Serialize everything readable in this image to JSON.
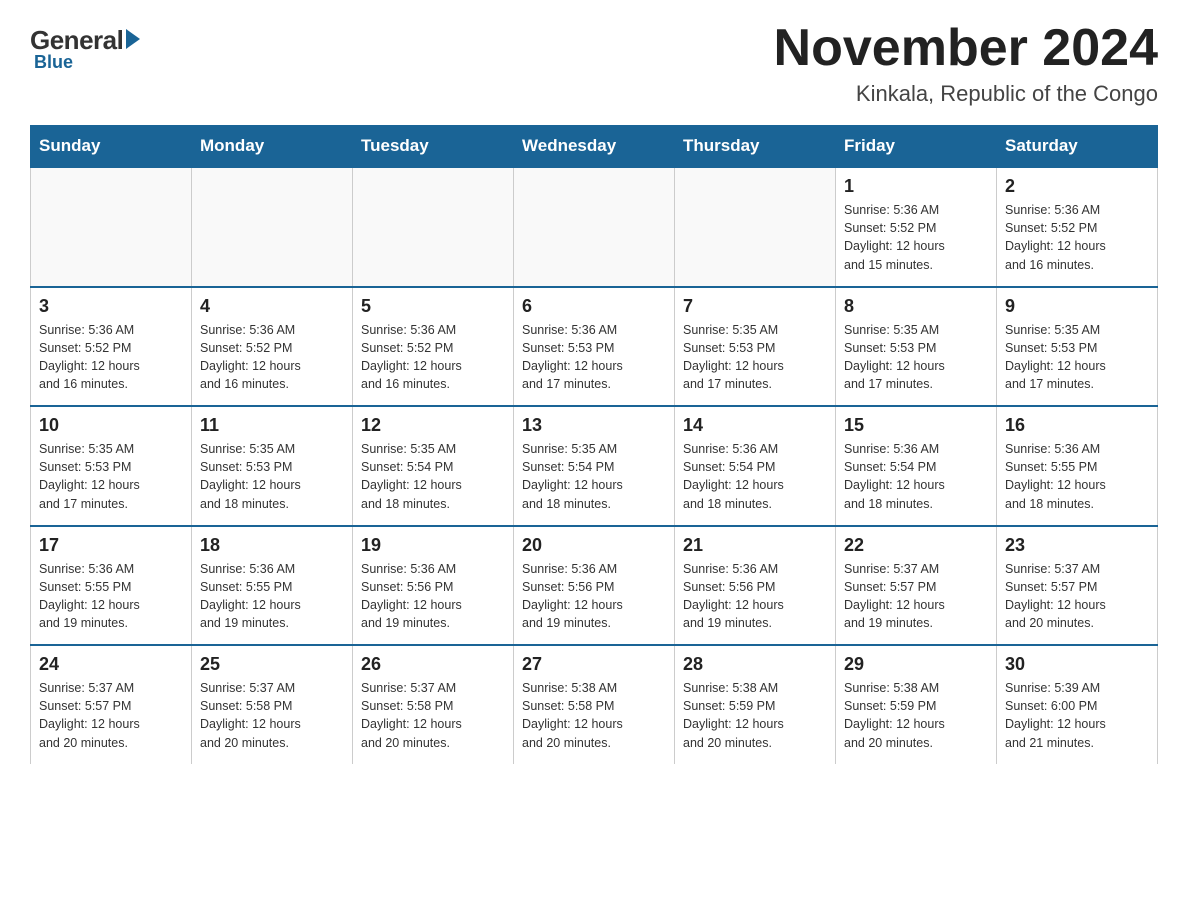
{
  "header": {
    "logo": {
      "general": "General",
      "blue": "Blue"
    },
    "title": "November 2024",
    "subtitle": "Kinkala, Republic of the Congo"
  },
  "days_of_week": [
    "Sunday",
    "Monday",
    "Tuesday",
    "Wednesday",
    "Thursday",
    "Friday",
    "Saturday"
  ],
  "weeks": [
    [
      {
        "day": "",
        "info": ""
      },
      {
        "day": "",
        "info": ""
      },
      {
        "day": "",
        "info": ""
      },
      {
        "day": "",
        "info": ""
      },
      {
        "day": "",
        "info": ""
      },
      {
        "day": "1",
        "info": "Sunrise: 5:36 AM\nSunset: 5:52 PM\nDaylight: 12 hours\nand 15 minutes."
      },
      {
        "day": "2",
        "info": "Sunrise: 5:36 AM\nSunset: 5:52 PM\nDaylight: 12 hours\nand 16 minutes."
      }
    ],
    [
      {
        "day": "3",
        "info": "Sunrise: 5:36 AM\nSunset: 5:52 PM\nDaylight: 12 hours\nand 16 minutes."
      },
      {
        "day": "4",
        "info": "Sunrise: 5:36 AM\nSunset: 5:52 PM\nDaylight: 12 hours\nand 16 minutes."
      },
      {
        "day": "5",
        "info": "Sunrise: 5:36 AM\nSunset: 5:52 PM\nDaylight: 12 hours\nand 16 minutes."
      },
      {
        "day": "6",
        "info": "Sunrise: 5:36 AM\nSunset: 5:53 PM\nDaylight: 12 hours\nand 17 minutes."
      },
      {
        "day": "7",
        "info": "Sunrise: 5:35 AM\nSunset: 5:53 PM\nDaylight: 12 hours\nand 17 minutes."
      },
      {
        "day": "8",
        "info": "Sunrise: 5:35 AM\nSunset: 5:53 PM\nDaylight: 12 hours\nand 17 minutes."
      },
      {
        "day": "9",
        "info": "Sunrise: 5:35 AM\nSunset: 5:53 PM\nDaylight: 12 hours\nand 17 minutes."
      }
    ],
    [
      {
        "day": "10",
        "info": "Sunrise: 5:35 AM\nSunset: 5:53 PM\nDaylight: 12 hours\nand 17 minutes."
      },
      {
        "day": "11",
        "info": "Sunrise: 5:35 AM\nSunset: 5:53 PM\nDaylight: 12 hours\nand 18 minutes."
      },
      {
        "day": "12",
        "info": "Sunrise: 5:35 AM\nSunset: 5:54 PM\nDaylight: 12 hours\nand 18 minutes."
      },
      {
        "day": "13",
        "info": "Sunrise: 5:35 AM\nSunset: 5:54 PM\nDaylight: 12 hours\nand 18 minutes."
      },
      {
        "day": "14",
        "info": "Sunrise: 5:36 AM\nSunset: 5:54 PM\nDaylight: 12 hours\nand 18 minutes."
      },
      {
        "day": "15",
        "info": "Sunrise: 5:36 AM\nSunset: 5:54 PM\nDaylight: 12 hours\nand 18 minutes."
      },
      {
        "day": "16",
        "info": "Sunrise: 5:36 AM\nSunset: 5:55 PM\nDaylight: 12 hours\nand 18 minutes."
      }
    ],
    [
      {
        "day": "17",
        "info": "Sunrise: 5:36 AM\nSunset: 5:55 PM\nDaylight: 12 hours\nand 19 minutes."
      },
      {
        "day": "18",
        "info": "Sunrise: 5:36 AM\nSunset: 5:55 PM\nDaylight: 12 hours\nand 19 minutes."
      },
      {
        "day": "19",
        "info": "Sunrise: 5:36 AM\nSunset: 5:56 PM\nDaylight: 12 hours\nand 19 minutes."
      },
      {
        "day": "20",
        "info": "Sunrise: 5:36 AM\nSunset: 5:56 PM\nDaylight: 12 hours\nand 19 minutes."
      },
      {
        "day": "21",
        "info": "Sunrise: 5:36 AM\nSunset: 5:56 PM\nDaylight: 12 hours\nand 19 minutes."
      },
      {
        "day": "22",
        "info": "Sunrise: 5:37 AM\nSunset: 5:57 PM\nDaylight: 12 hours\nand 19 minutes."
      },
      {
        "day": "23",
        "info": "Sunrise: 5:37 AM\nSunset: 5:57 PM\nDaylight: 12 hours\nand 20 minutes."
      }
    ],
    [
      {
        "day": "24",
        "info": "Sunrise: 5:37 AM\nSunset: 5:57 PM\nDaylight: 12 hours\nand 20 minutes."
      },
      {
        "day": "25",
        "info": "Sunrise: 5:37 AM\nSunset: 5:58 PM\nDaylight: 12 hours\nand 20 minutes."
      },
      {
        "day": "26",
        "info": "Sunrise: 5:37 AM\nSunset: 5:58 PM\nDaylight: 12 hours\nand 20 minutes."
      },
      {
        "day": "27",
        "info": "Sunrise: 5:38 AM\nSunset: 5:58 PM\nDaylight: 12 hours\nand 20 minutes."
      },
      {
        "day": "28",
        "info": "Sunrise: 5:38 AM\nSunset: 5:59 PM\nDaylight: 12 hours\nand 20 minutes."
      },
      {
        "day": "29",
        "info": "Sunrise: 5:38 AM\nSunset: 5:59 PM\nDaylight: 12 hours\nand 20 minutes."
      },
      {
        "day": "30",
        "info": "Sunrise: 5:39 AM\nSunset: 6:00 PM\nDaylight: 12 hours\nand 21 minutes."
      }
    ]
  ]
}
